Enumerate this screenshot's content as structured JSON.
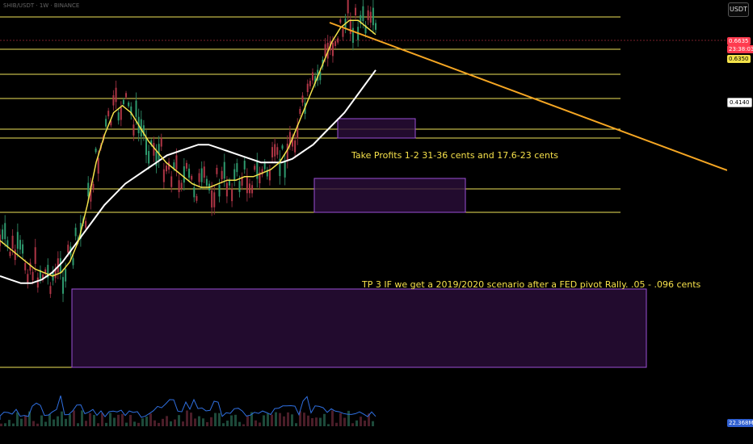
{
  "symbol_line": "SHIB/USDT · 1W · BINANCE",
  "currency_button": "USDT",
  "price_labels": {
    "current": "0.6635",
    "countdown": "23:38:03",
    "ema_fast": "0.6350",
    "ema_slow": "0.4140",
    "volume": "22.368M"
  },
  "annotations": {
    "tp12": "Take Profits 1-2 31-36 cents and 17.6-23 cents",
    "tp3": "TP 3 IF we get a 2019/2020 scenario after a FED pivot Rally. .05 - .096 cents"
  },
  "colors": {
    "background": "#000000",
    "level_line": "#f1e35a",
    "trendline": "#f5a623",
    "ema_fast": "#f4e24a",
    "ema_slow": "#ffffff",
    "zone_border": "#9b4fd6",
    "zone_fill": "#2a0e3a",
    "volume_line": "#2f6fe0",
    "current_price_bg": "#ff3b4f",
    "ema_fast_bg": "#f4e24a"
  },
  "chart_data": {
    "type": "line",
    "series": [
      {
        "values": [
          0.3,
          0.28,
          0.26,
          0.24,
          0.22,
          0.21,
          0.2,
          0.21,
          0.24,
          0.3,
          0.4,
          0.52,
          0.6,
          0.66,
          0.68,
          0.66,
          0.62,
          0.58,
          0.55,
          0.52,
          0.5,
          0.48,
          0.46,
          0.45,
          0.45,
          0.46,
          0.47,
          0.47,
          0.48,
          0.48,
          0.49,
          0.5,
          0.52,
          0.56,
          0.62,
          0.68,
          0.74,
          0.8,
          0.86,
          0.9,
          0.92,
          0.92,
          0.9,
          0.88
        ]
      },
      {
        "values": [
          0.2,
          0.19,
          0.18,
          0.18,
          0.19,
          0.21,
          0.24,
          0.28,
          0.32,
          0.36,
          0.4,
          0.43,
          0.46,
          0.48,
          0.5,
          0.52,
          0.54,
          0.55,
          0.56,
          0.57,
          0.57,
          0.56,
          0.55,
          0.54,
          0.53,
          0.52,
          0.52,
          0.52,
          0.53,
          0.55,
          0.57,
          0.6,
          0.63,
          0.66,
          0.7,
          0.74,
          0.78
        ]
      }
    ],
    "price_levels": [
      0.6635,
      0.635,
      0.414
    ],
    "trendline": {
      "from": 0.9,
      "to": 0.42
    }
  }
}
